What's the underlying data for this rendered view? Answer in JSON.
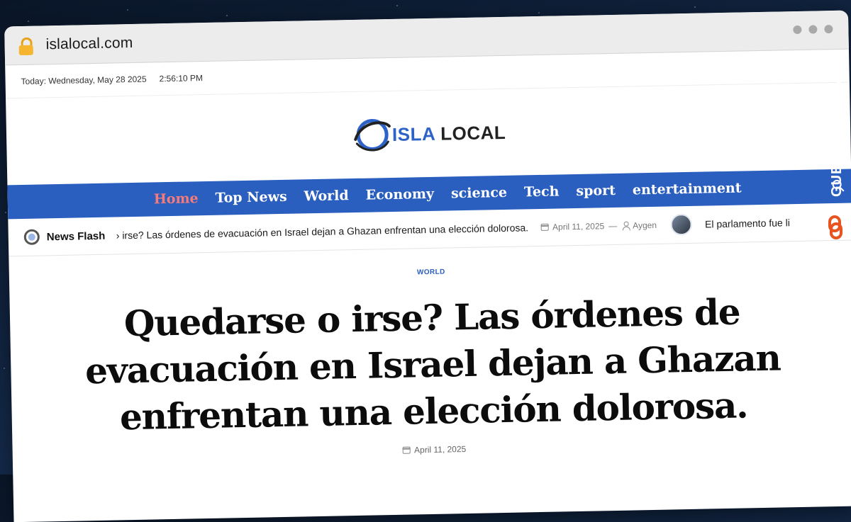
{
  "browser": {
    "url": "islalocal.com"
  },
  "topbar": {
    "today": "Today: Wednesday, May 28 2025",
    "time": "2:56:10 PM"
  },
  "logo": {
    "word1": "ISLA",
    "word2": "LOCAL",
    "accent": "#2d63c8"
  },
  "nav": {
    "items": [
      {
        "label": "Home",
        "active": true
      },
      {
        "label": "Top News"
      },
      {
        "label": "World"
      },
      {
        "label": "Economy"
      },
      {
        "label": "science"
      },
      {
        "label": "Tech"
      },
      {
        "label": "sport"
      },
      {
        "label": "entertainment"
      }
    ],
    "search_icon": "search-icon",
    "bar_color": "#2b5fbf"
  },
  "ticker": {
    "label": "News Flash",
    "headline": "› irse? Las órdenes de evacuación en Israel dejan a Ghazan enfrentan una elección dolorosa.",
    "date": "April 11, 2025",
    "separator": "—",
    "author": "Aygen",
    "next_headline": "El parlamento fue li"
  },
  "article": {
    "category": "WORLD",
    "title": "Quedarse o irse? Las órdenes de evacuación en Israel dejan a Ghazan enfrentan una elección dolorosa.",
    "date": "April 11, 2025"
  },
  "watermark": {
    "text": "GUESTPOSTLINKS",
    "color": "#e8541f"
  }
}
